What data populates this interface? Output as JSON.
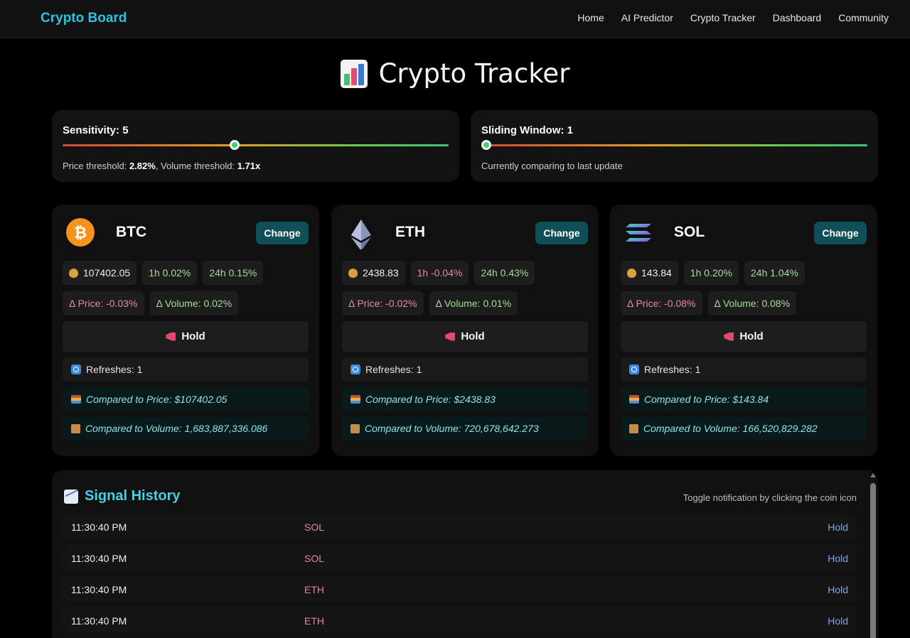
{
  "nav": {
    "brand": "Crypto Board",
    "links": [
      "Home",
      "AI Predictor",
      "Crypto Tracker",
      "Dashboard",
      "Community"
    ]
  },
  "page": {
    "title": "Crypto Tracker",
    "title_icon": "bar-chart-icon"
  },
  "sensitivity": {
    "label": "Sensitivity: 5",
    "value": 5,
    "note_prefix": "Price threshold: ",
    "price_threshold": "2.82%",
    "note_mid": ", Volume threshold: ",
    "volume_threshold": "1.71x"
  },
  "sliding_window": {
    "label": "Sliding Window: 1",
    "value": 1,
    "note": "Currently comparing to last update"
  },
  "coins": [
    {
      "symbol": "BTC",
      "icon": "bitcoin-icon",
      "change_label": "Change",
      "price": "107402.05",
      "h1": "1h 0.02%",
      "h24": "24h 0.15%",
      "delta_price": "Δ Price: -0.03%",
      "delta_volume": "Δ Volume: 0.02%",
      "signal": "Hold",
      "refreshes": "Refreshes: 1",
      "compared_price": "Compared to Price: $107402.05",
      "compared_volume": "Compared to Volume: 1,683,887,336.086"
    },
    {
      "symbol": "ETH",
      "icon": "ethereum-icon",
      "change_label": "Change",
      "price": "2438.83",
      "h1": "1h -0.04%",
      "h24": "24h 0.43%",
      "delta_price": "Δ Price: -0.02%",
      "delta_volume": "Δ Volume: 0.01%",
      "signal": "Hold",
      "refreshes": "Refreshes: 1",
      "compared_price": "Compared to Price: $2438.83",
      "compared_volume": "Compared to Volume: 720,678,642.273"
    },
    {
      "symbol": "SOL",
      "icon": "solana-icon",
      "change_label": "Change",
      "price": "143.84",
      "h1": "1h 0.20%",
      "h24": "24h 1.04%",
      "delta_price": "Δ Price: -0.08%",
      "delta_volume": "Δ Volume: 0.08%",
      "signal": "Hold",
      "refreshes": "Refreshes: 1",
      "compared_price": "Compared to Price: $143.84",
      "compared_volume": "Compared to Volume: 166,520,829.282"
    }
  ],
  "history": {
    "title": "Signal History",
    "hint": "Toggle notification by clicking the coin icon",
    "rows": [
      {
        "time": "11:30:40 PM",
        "coin": "SOL",
        "signal": "Hold"
      },
      {
        "time": "11:30:40 PM",
        "coin": "SOL",
        "signal": "Hold"
      },
      {
        "time": "11:30:40 PM",
        "coin": "ETH",
        "signal": "Hold"
      },
      {
        "time": "11:30:40 PM",
        "coin": "ETH",
        "signal": "Hold"
      }
    ]
  },
  "colors": {
    "accent": "#2bc4dd",
    "button": "#0e4f58",
    "positive": "#a6dc9a",
    "negative": "#e58b95"
  }
}
